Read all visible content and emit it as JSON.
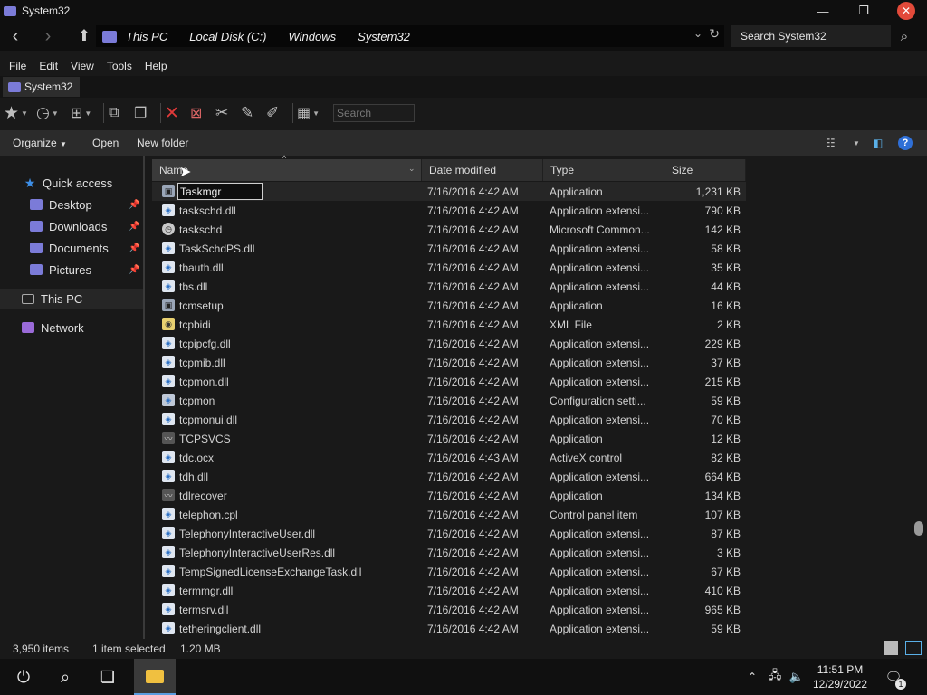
{
  "window": {
    "title": "System32",
    "minimize": "—",
    "maximize": "❐",
    "close": "✕"
  },
  "address": {
    "crumbs": [
      "This PC",
      "Local Disk (C:)",
      "Windows",
      "System32"
    ],
    "search_placeholder": "Search System32"
  },
  "menu": [
    "File",
    "Edit",
    "View",
    "Tools",
    "Help"
  ],
  "tab": {
    "label": "System32"
  },
  "toolbar": {
    "search_placeholder": "Search"
  },
  "commands": {
    "organize": "Organize",
    "open": "Open",
    "new_folder": "New folder"
  },
  "nav": {
    "quick_access": "Quick access",
    "items": [
      "Desktop",
      "Downloads",
      "Documents",
      "Pictures"
    ],
    "this_pc": "This PC",
    "network": "Network"
  },
  "columns": {
    "name": "Name",
    "date": "Date modified",
    "type": "Type",
    "size": "Size"
  },
  "rename_value": "Taskmgr",
  "files": [
    {
      "name": "Taskmgr",
      "date": "7/16/2016 4:42 AM",
      "type": "Application",
      "size": "1,231 KB",
      "icon": "app"
    },
    {
      "name": "taskschd.dll",
      "date": "7/16/2016 4:42 AM",
      "type": "Application extensi...",
      "size": "790 KB",
      "icon": "dll"
    },
    {
      "name": "taskschd",
      "date": "7/16/2016 4:42 AM",
      "type": "Microsoft Common...",
      "size": "142 KB",
      "icon": "sched"
    },
    {
      "name": "TaskSchdPS.dll",
      "date": "7/16/2016 4:42 AM",
      "type": "Application extensi...",
      "size": "58 KB",
      "icon": "dll"
    },
    {
      "name": "tbauth.dll",
      "date": "7/16/2016 4:42 AM",
      "type": "Application extensi...",
      "size": "35 KB",
      "icon": "dll"
    },
    {
      "name": "tbs.dll",
      "date": "7/16/2016 4:42 AM",
      "type": "Application extensi...",
      "size": "44 KB",
      "icon": "dll"
    },
    {
      "name": "tcmsetup",
      "date": "7/16/2016 4:42 AM",
      "type": "Application",
      "size": "16 KB",
      "icon": "app"
    },
    {
      "name": "tcpbidi",
      "date": "7/16/2016 4:42 AM",
      "type": "XML File",
      "size": "2 KB",
      "icon": "xml"
    },
    {
      "name": "tcpipcfg.dll",
      "date": "7/16/2016 4:42 AM",
      "type": "Application extensi...",
      "size": "229 KB",
      "icon": "dll"
    },
    {
      "name": "tcpmib.dll",
      "date": "7/16/2016 4:42 AM",
      "type": "Application extensi...",
      "size": "37 KB",
      "icon": "dll"
    },
    {
      "name": "tcpmon.dll",
      "date": "7/16/2016 4:42 AM",
      "type": "Application extensi...",
      "size": "215 KB",
      "icon": "dll"
    },
    {
      "name": "tcpmon",
      "date": "7/16/2016 4:42 AM",
      "type": "Configuration setti...",
      "size": "59 KB",
      "icon": "cfg"
    },
    {
      "name": "tcpmonui.dll",
      "date": "7/16/2016 4:42 AM",
      "type": "Application extensi...",
      "size": "70 KB",
      "icon": "dll"
    },
    {
      "name": "TCPSVCS",
      "date": "7/16/2016 4:42 AM",
      "type": "Application",
      "size": "12 KB",
      "icon": "svc"
    },
    {
      "name": "tdc.ocx",
      "date": "7/16/2016 4:43 AM",
      "type": "ActiveX control",
      "size": "82 KB",
      "icon": "dll"
    },
    {
      "name": "tdh.dll",
      "date": "7/16/2016 4:42 AM",
      "type": "Application extensi...",
      "size": "664 KB",
      "icon": "dll"
    },
    {
      "name": "tdlrecover",
      "date": "7/16/2016 4:42 AM",
      "type": "Application",
      "size": "134 KB",
      "icon": "svc"
    },
    {
      "name": "telephon.cpl",
      "date": "7/16/2016 4:42 AM",
      "type": "Control panel item",
      "size": "107 KB",
      "icon": "dll"
    },
    {
      "name": "TelephonyInteractiveUser.dll",
      "date": "7/16/2016 4:42 AM",
      "type": "Application extensi...",
      "size": "87 KB",
      "icon": "dll"
    },
    {
      "name": "TelephonyInteractiveUserRes.dll",
      "date": "7/16/2016 4:42 AM",
      "type": "Application extensi...",
      "size": "3 KB",
      "icon": "dll"
    },
    {
      "name": "TempSignedLicenseExchangeTask.dll",
      "date": "7/16/2016 4:42 AM",
      "type": "Application extensi...",
      "size": "67 KB",
      "icon": "dll"
    },
    {
      "name": "termmgr.dll",
      "date": "7/16/2016 4:42 AM",
      "type": "Application extensi...",
      "size": "410 KB",
      "icon": "dll"
    },
    {
      "name": "termsrv.dll",
      "date": "7/16/2016 4:42 AM",
      "type": "Application extensi...",
      "size": "965 KB",
      "icon": "dll"
    },
    {
      "name": "tetheringclient.dll",
      "date": "7/16/2016 4:42 AM",
      "type": "Application extensi...",
      "size": "59 KB",
      "icon": "dll"
    }
  ],
  "status": {
    "items": "3,950 items",
    "selected": "1 item selected",
    "size": "1.20 MB"
  },
  "taskbar": {
    "time": "11:51 PM",
    "date": "12/29/2022",
    "notifications": "1"
  },
  "colors": {
    "accent": "#7b7bd8",
    "close": "#e24a3a",
    "pin": "#3d8ee6"
  }
}
